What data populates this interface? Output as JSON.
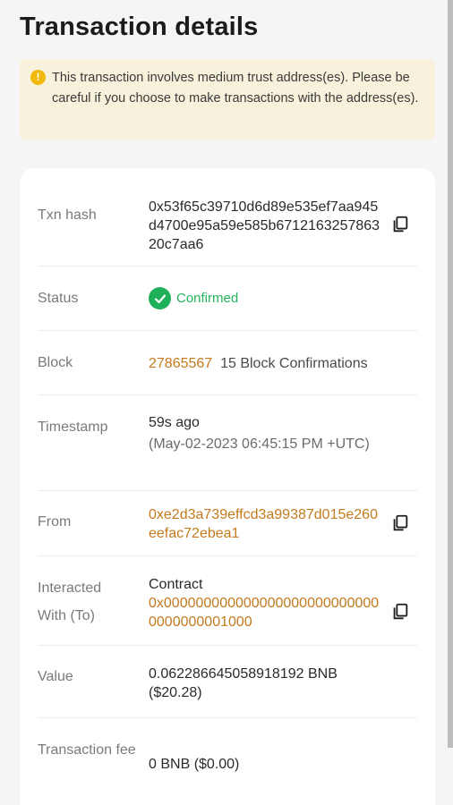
{
  "page": {
    "title": "Transaction details"
  },
  "warning": {
    "icon": "exclamation-icon",
    "text": "This transaction involves medium trust address(es). Please be careful if you choose to make transactions with the address(es)."
  },
  "details": {
    "txn_hash": {
      "label": "Txn hash",
      "value": "0x53f65c39710d6d89e535ef7aa945d4700e95a59e585b671216325786320c7aa6"
    },
    "status": {
      "label": "Status",
      "value": "Confirmed",
      "color": "#1fb15a"
    },
    "block": {
      "label": "Block",
      "number": "27865567",
      "confirmations": "15 Block Confirmations"
    },
    "timestamp": {
      "label": "Timestamp",
      "relative": "59s ago",
      "absolute": "(May-02-2023 06:45:15 PM +UTC)"
    },
    "from": {
      "label": "From",
      "value": "0xe2d3a739effcd3a99387d015e260eefac72ebea1"
    },
    "to": {
      "label": "Interacted With (To)",
      "type": "Contract",
      "value": "0x0000000000000000000000000000000000001000"
    },
    "value": {
      "label": "Value",
      "amount": "0.062286645058918192 BNB",
      "fiat": "($20.28)"
    },
    "fee": {
      "label": "Transaction fee",
      "value": "0 BNB ($0.00)"
    }
  },
  "colors": {
    "link": "#c47a1d",
    "warning_bg": "#f8f2dc",
    "accent": "#f0b90b"
  }
}
